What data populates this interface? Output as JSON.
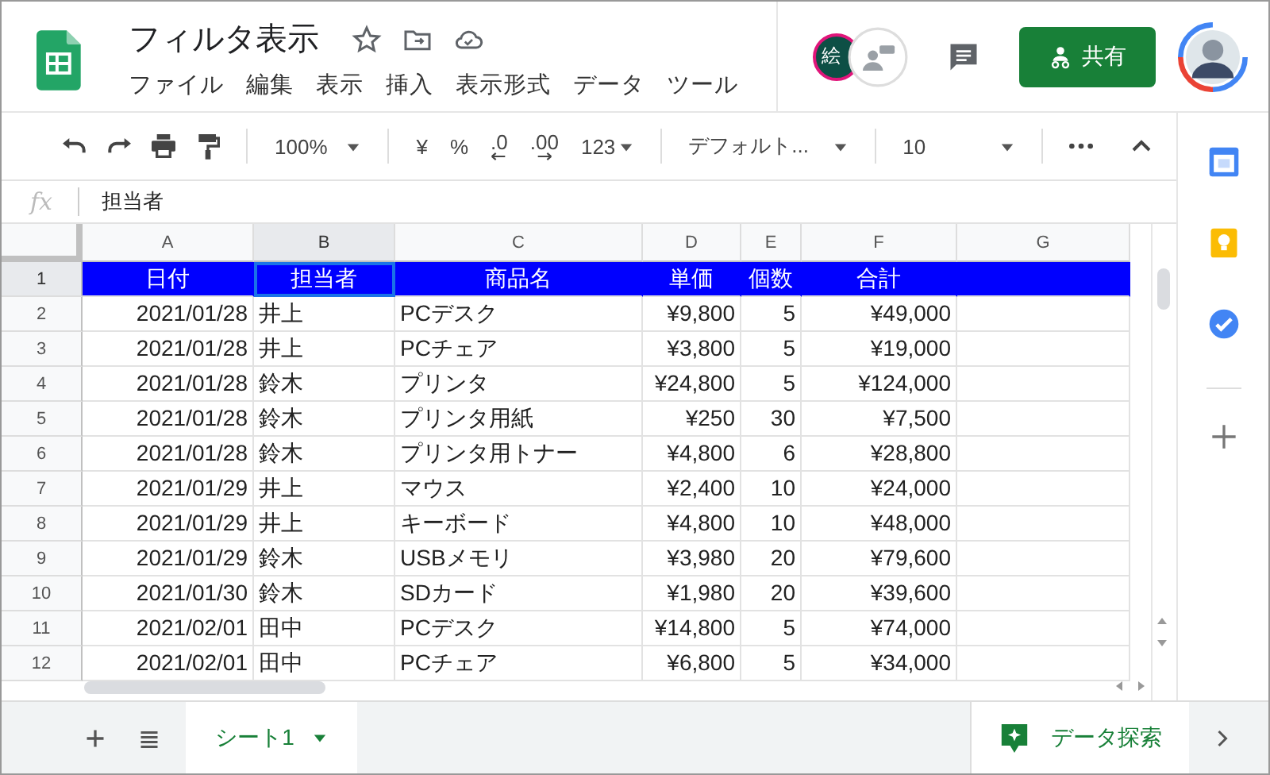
{
  "doc": {
    "title": "フィルタ表示",
    "menus": [
      "ファイル",
      "編集",
      "表示",
      "挿入",
      "表示形式",
      "データ",
      "ツール"
    ]
  },
  "collaborators": {
    "initials": "絵"
  },
  "share_button": {
    "label": "共有"
  },
  "toolbar": {
    "zoom": "100%",
    "currency": "¥",
    "percent": "%",
    "dec_less": ".0",
    "dec_more": ".00",
    "number_format": "123",
    "font": "デフォルト...",
    "font_size": "10"
  },
  "formula_bar": {
    "fx": "fx",
    "value": "担当者"
  },
  "columns": [
    {
      "label": "A",
      "selected": false
    },
    {
      "label": "B",
      "selected": true
    },
    {
      "label": "C",
      "selected": false
    },
    {
      "label": "D",
      "selected": false
    },
    {
      "label": "E",
      "selected": false
    },
    {
      "label": "F",
      "selected": false
    },
    {
      "label": "G",
      "selected": false
    }
  ],
  "rows": [
    {
      "number": "1",
      "selected": true,
      "kind": "header",
      "cells": [
        "日付",
        "担当者",
        "商品名",
        "単価",
        "個数",
        "合計"
      ]
    },
    {
      "number": "2",
      "selected": false,
      "kind": "data",
      "cells": [
        "2021/01/28",
        "井上",
        "PCデスク",
        "¥9,800",
        "5",
        "¥49,000"
      ]
    },
    {
      "number": "3",
      "selected": false,
      "kind": "data",
      "cells": [
        "2021/01/28",
        "井上",
        "PCチェア",
        "¥3,800",
        "5",
        "¥19,000"
      ]
    },
    {
      "number": "4",
      "selected": false,
      "kind": "data",
      "cells": [
        "2021/01/28",
        "鈴木",
        "プリンタ",
        "¥24,800",
        "5",
        "¥124,000"
      ]
    },
    {
      "number": "5",
      "selected": false,
      "kind": "data",
      "cells": [
        "2021/01/28",
        "鈴木",
        "プリンタ用紙",
        "¥250",
        "30",
        "¥7,500"
      ]
    },
    {
      "number": "6",
      "selected": false,
      "kind": "data",
      "cells": [
        "2021/01/28",
        "鈴木",
        "プリンタ用トナー",
        "¥4,800",
        "6",
        "¥28,800"
      ]
    },
    {
      "number": "7",
      "selected": false,
      "kind": "data",
      "cells": [
        "2021/01/29",
        "井上",
        "マウス",
        "¥2,400",
        "10",
        "¥24,000"
      ]
    },
    {
      "number": "8",
      "selected": false,
      "kind": "data",
      "cells": [
        "2021/01/29",
        "井上",
        "キーボード",
        "¥4,800",
        "10",
        "¥48,000"
      ]
    },
    {
      "number": "9",
      "selected": false,
      "kind": "data",
      "cells": [
        "2021/01/29",
        "鈴木",
        "USBメモリ",
        "¥3,980",
        "20",
        "¥79,600"
      ]
    },
    {
      "number": "10",
      "selected": false,
      "kind": "data",
      "cells": [
        "2021/01/30",
        "鈴木",
        "SDカード",
        "¥1,980",
        "20",
        "¥39,600"
      ]
    },
    {
      "number": "11",
      "selected": false,
      "kind": "data",
      "cells": [
        "2021/02/01",
        "田中",
        "PCデスク",
        "¥14,800",
        "5",
        "¥74,000"
      ]
    },
    {
      "number": "12",
      "selected": false,
      "kind": "data",
      "cells": [
        "2021/02/01",
        "田中",
        "PCチェア",
        "¥6,800",
        "5",
        "¥34,000"
      ]
    }
  ],
  "sheet_tabs": [
    {
      "label": "シート1",
      "selected": true
    }
  ],
  "explore_button": {
    "label": "データ探索"
  }
}
